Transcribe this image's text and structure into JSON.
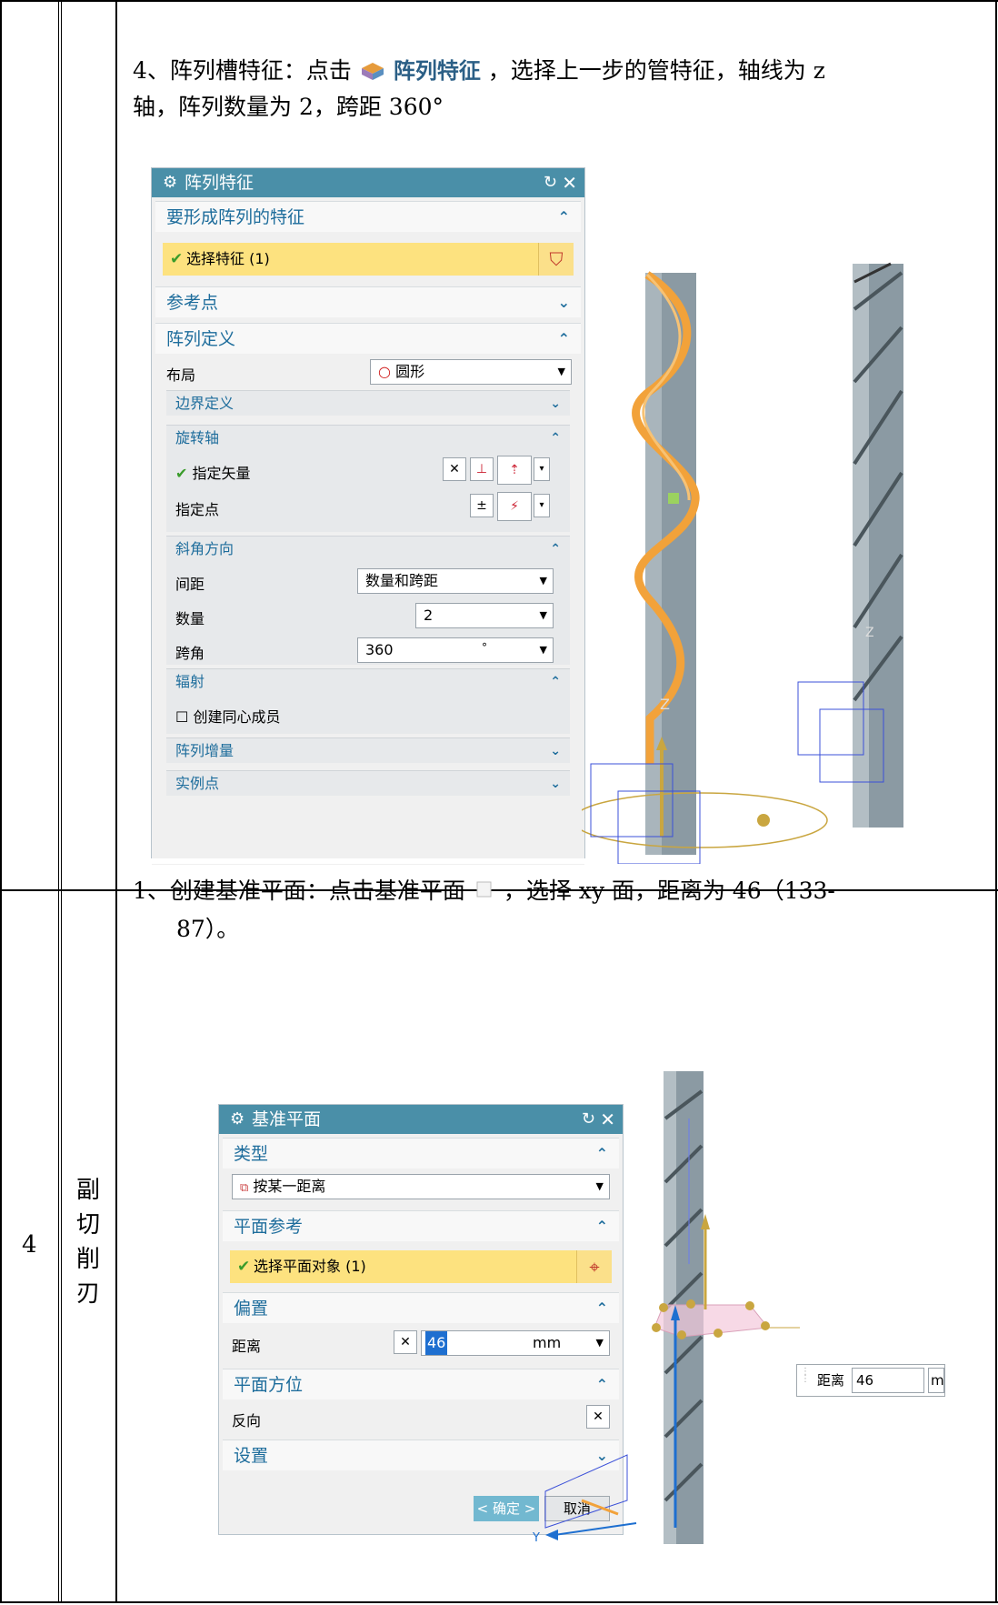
{
  "upper_step": {
    "line1_pre": "4、阵列槽特征：点击",
    "icon_label": "阵列特征",
    "line1_post": "，选择上一步的管特征，轴线为 z",
    "line2": "轴，阵列数量为 2，跨距 360°"
  },
  "pattern_dialog": {
    "title": "阵列特征",
    "group_features": "要形成阵列的特征",
    "select_feature": "选择特征 (1)",
    "group_reference": "参考点",
    "group_definition": "阵列定义",
    "layout_label": "布局",
    "layout_value": "圆形",
    "sub_boundary": "边界定义",
    "sub_rotation_axis": "旋转轴",
    "specify_vector": "指定矢量",
    "specify_point": "指定点",
    "sub_angle_direction": "斜角方向",
    "spacing_label": "间距",
    "spacing_value": "数量和跨距",
    "count_label": "数量",
    "count_value": "2",
    "span_label": "跨角",
    "span_value": "360",
    "span_unit": "°",
    "sub_radiate": "辐射",
    "concentric_label": "创建同心成员",
    "sub_increment": "阵列增量",
    "sub_instance": "实例点"
  },
  "table": {
    "row_number": "4",
    "row_name": [
      "副",
      "切",
      "削",
      "刃"
    ]
  },
  "lower_step": {
    "line1_pre": "1、创建基准平面：点击基准平面",
    "line1_post": "，选择 xy 面，距离为 46（133-",
    "line2": "87）。"
  },
  "datum_dialog": {
    "title": "基准平面",
    "group_type": "类型",
    "type_value": "按某一距离",
    "group_plane_ref": "平面参考",
    "select_plane": "选择平面对象 (1)",
    "group_offset": "偏置",
    "distance_label": "距离",
    "distance_value": "46",
    "distance_unit": "mm",
    "group_orientation": "平面方位",
    "reverse_label": "反向",
    "group_settings": "设置",
    "ok_label": "< 确定 >",
    "cancel_label": "取消"
  },
  "float_input": {
    "label": "距离",
    "value": "46",
    "unit": "m"
  },
  "axis_labels": {
    "z1": "Z",
    "z2": "Z",
    "y": "Y"
  },
  "colors": {
    "header_blue": "#4a8fa8",
    "select_yellow": "#fde27f",
    "tool_orange": "#f2a23a",
    "tool_gray": "#8b9aa3"
  }
}
